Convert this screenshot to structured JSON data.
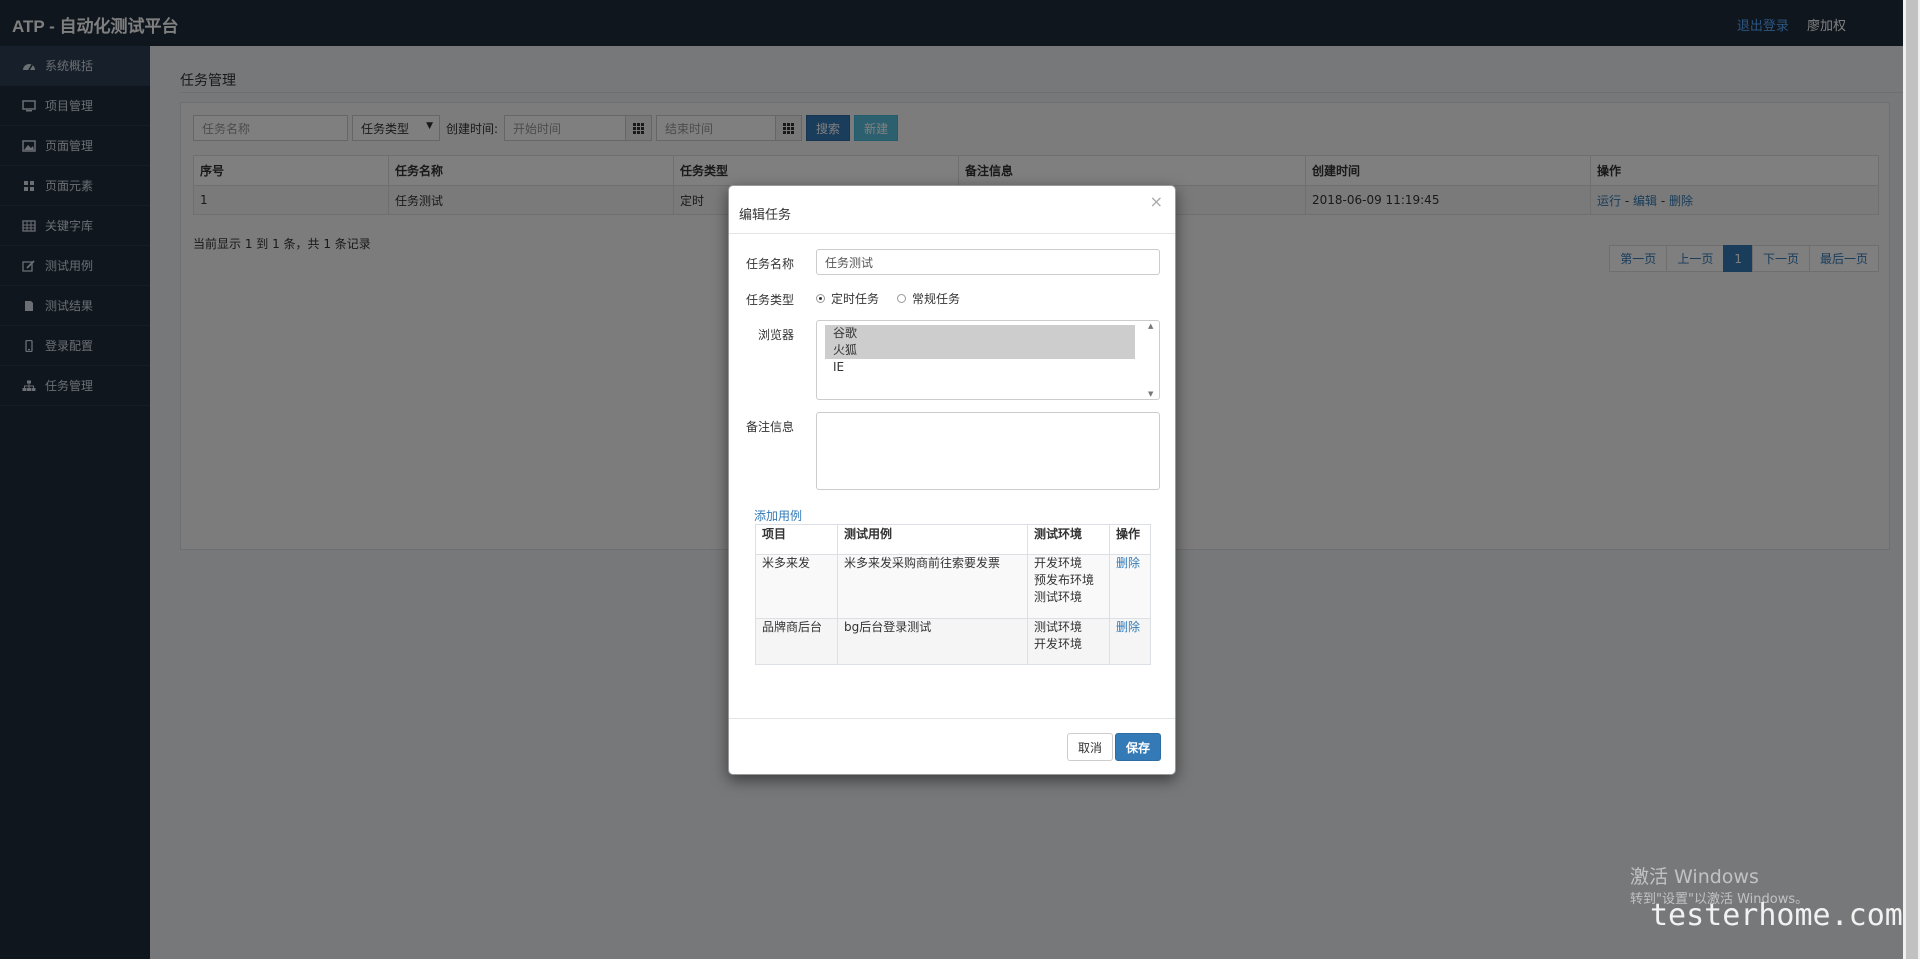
{
  "header": {
    "brand": "ATP - 自动化测试平台",
    "logout": "退出登录",
    "user": "廖加权"
  },
  "sidebar": {
    "items": [
      {
        "label": "系统概括",
        "icon": "dashboard-icon"
      },
      {
        "label": "项目管理",
        "icon": "monitor-icon"
      },
      {
        "label": "页面管理",
        "icon": "image-icon"
      },
      {
        "label": "页面元素",
        "icon": "grid-icon"
      },
      {
        "label": "关键字库",
        "icon": "table-icon"
      },
      {
        "label": "测试用例",
        "icon": "edit-icon"
      },
      {
        "label": "测试结果",
        "icon": "file-icon"
      },
      {
        "label": "登录配置",
        "icon": "phone-icon"
      },
      {
        "label": "任务管理",
        "icon": "sitemap-icon"
      }
    ]
  },
  "page": {
    "title": "任务管理",
    "filter": {
      "task_name_placeholder": "任务名称",
      "task_type": "任务类型",
      "created_label": "创建时间:",
      "start_placeholder": "开始时间",
      "end_placeholder": "结束时间",
      "search": "搜索",
      "new": "新建"
    },
    "table": {
      "headers": [
        "序号",
        "任务名称",
        "任务类型",
        "备注信息",
        "创建时间",
        "操作"
      ],
      "rows": [
        {
          "id": "1",
          "name": "任务测试",
          "type": "定时",
          "note": "",
          "created": "2018-06-09 11:19:45"
        }
      ],
      "actions": {
        "run": "运行",
        "edit": "编辑",
        "delete": "删除",
        "sep": "-"
      }
    },
    "record_info": "当前显示 1 到 1 条，共 1 条记录",
    "pager": {
      "first": "第一页",
      "prev": "上一页",
      "current": "1",
      "next": "下一页",
      "last": "最后一页"
    }
  },
  "modal": {
    "title": "编辑任务",
    "close": "×",
    "task_name_label": "任务名称",
    "task_name_value": "任务测试",
    "task_type_label": "任务类型",
    "type_timed": "定时任务",
    "type_normal": "常规任务",
    "browser_label": "浏览器",
    "browsers": [
      {
        "label": "谷歌",
        "selected": true
      },
      {
        "label": "火狐",
        "selected": true
      },
      {
        "label": "IE",
        "selected": false
      }
    ],
    "note_label": "备注信息",
    "add_case": "添加用例",
    "case_headers": [
      "项目",
      "测试用例",
      "测试环境",
      "操作"
    ],
    "cases": [
      {
        "project": "米多来发",
        "case": "米多来发采购商前往索要发票",
        "envs": [
          "开发环境",
          "预发布环境",
          "测试环境"
        ],
        "action": "删除"
      },
      {
        "project": "品牌商后台",
        "case": "bg后台登录测试",
        "envs": [
          "测试环境",
          "开发环境"
        ],
        "action": "删除"
      }
    ],
    "cancel": "取消",
    "save": "保存"
  },
  "watermark": {
    "line1": "激活 Windows",
    "line2": "转到\"设置\"以激活 Windows。",
    "site": "testerhome.com"
  }
}
